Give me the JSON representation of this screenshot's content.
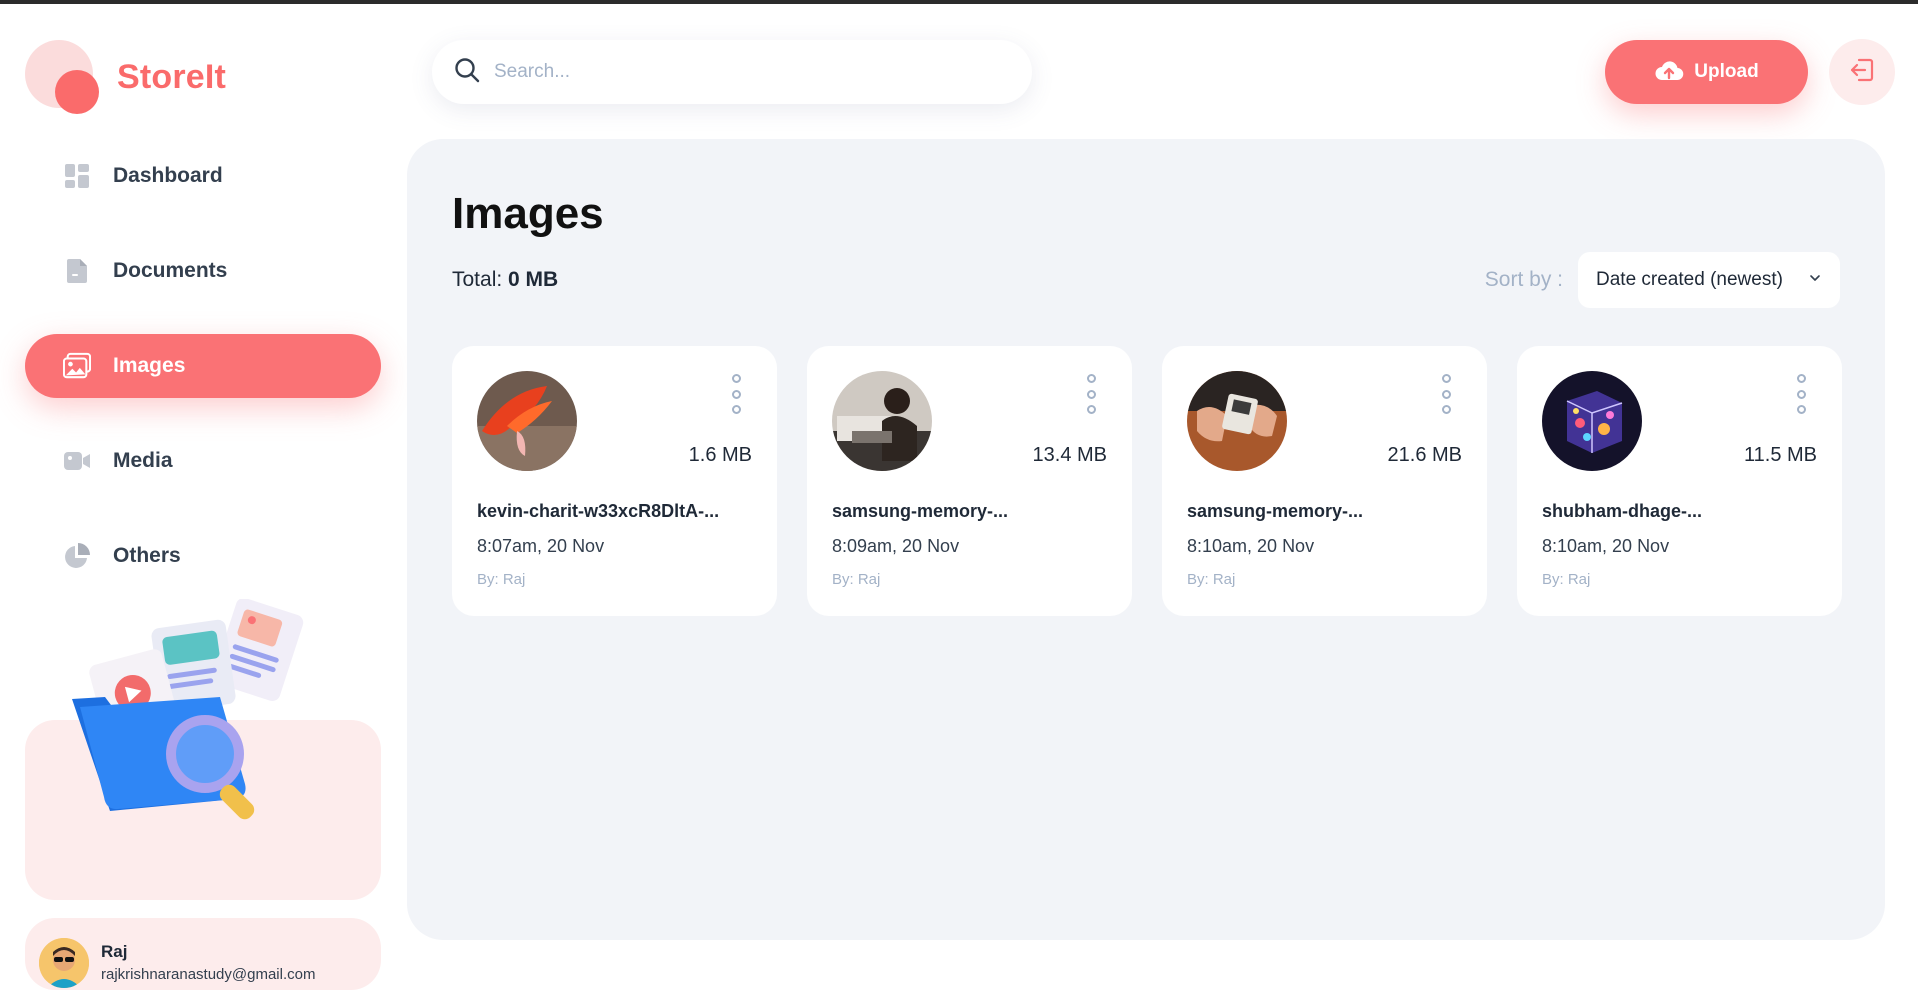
{
  "app": {
    "name": "StoreIt"
  },
  "sidebar": {
    "items": [
      {
        "label": "Dashboard",
        "icon": "dashboard-icon",
        "active": false
      },
      {
        "label": "Documents",
        "icon": "document-icon",
        "active": false
      },
      {
        "label": "Images",
        "icon": "images-icon",
        "active": true
      },
      {
        "label": "Media",
        "icon": "video-icon",
        "active": false
      },
      {
        "label": "Others",
        "icon": "pie-chart-icon",
        "active": false
      }
    ]
  },
  "user": {
    "name": "Raj",
    "email": "rajkrishnaranastudy@gmail.com"
  },
  "search": {
    "placeholder": "Search..."
  },
  "header": {
    "upload_label": "Upload"
  },
  "main": {
    "title": "Images",
    "total_label": "Total:",
    "total_value": "0 MB",
    "sort_label": "Sort by :",
    "sort_value": "Date created (newest)"
  },
  "files": [
    {
      "name": "kevin-charit-w33xcR8DltA-...",
      "size": "1.6 MB",
      "date": "8:07am, 20 Nov",
      "owner": "By: Raj"
    },
    {
      "name": "samsung-memory-...",
      "size": "13.4 MB",
      "date": "8:09am, 20 Nov",
      "owner": "By: Raj"
    },
    {
      "name": "samsung-memory-...",
      "size": "21.6 MB",
      "date": "8:10am, 20 Nov",
      "owner": "By: Raj"
    },
    {
      "name": "shubham-dhage-...",
      "size": "11.5 MB",
      "date": "8:10am, 20 Nov",
      "owner": "By: Raj"
    }
  ],
  "colors": {
    "brand": "#fa7275",
    "brand_light": "#fdecec",
    "main_bg": "#f2f4f8",
    "muted": "#a3b2c7"
  }
}
